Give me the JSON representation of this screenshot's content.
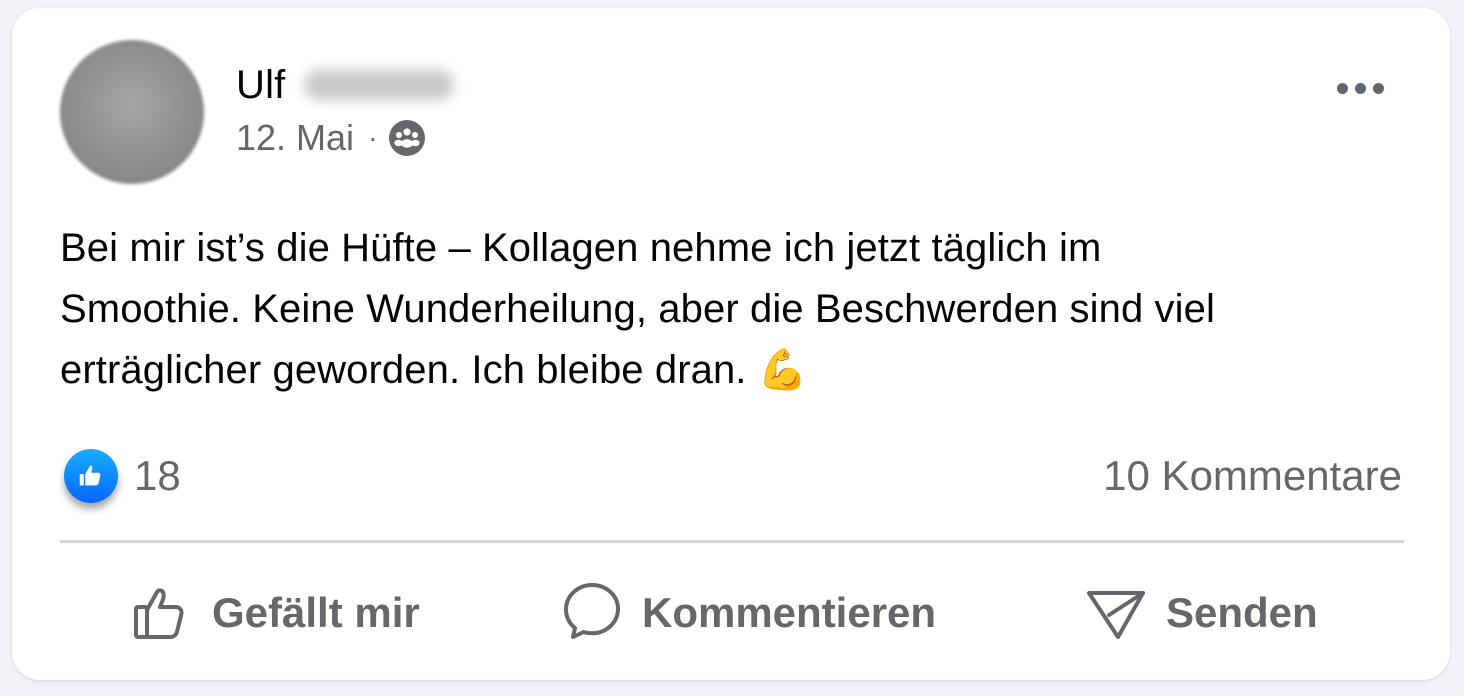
{
  "post": {
    "author": {
      "name": "Ulf",
      "surname_blurred": true
    },
    "date": "12. Mai",
    "separator": "·",
    "audience_icon": "group-icon",
    "more_icon": "more-horizontal-icon",
    "text_lines": [
      "Bei mir ist’s die Hüfte – Kollagen nehme ich jetzt täglich im",
      "Smoothie. Keine Wunderheilung, aber die Beschwerden sind viel",
      "erträglicher geworden. Ich bleibe dran."
    ],
    "emoji": "💪"
  },
  "stats": {
    "reaction_icon": "like-reaction-icon",
    "likes": "18",
    "comments": "10 Kommentare"
  },
  "actions": {
    "like": {
      "label": "Gefällt mir",
      "icon": "thumbs-up-icon"
    },
    "comment": {
      "label": "Kommentieren",
      "icon": "comment-bubble-icon"
    },
    "send": {
      "label": "Senden",
      "icon": "send-icon"
    }
  },
  "colors": {
    "background": "#f0f2f5",
    "card": "#ffffff",
    "text_primary": "#050505",
    "text_secondary": "#65676b",
    "like_blue": "#0866ff",
    "divider": "#d2d4d8"
  }
}
